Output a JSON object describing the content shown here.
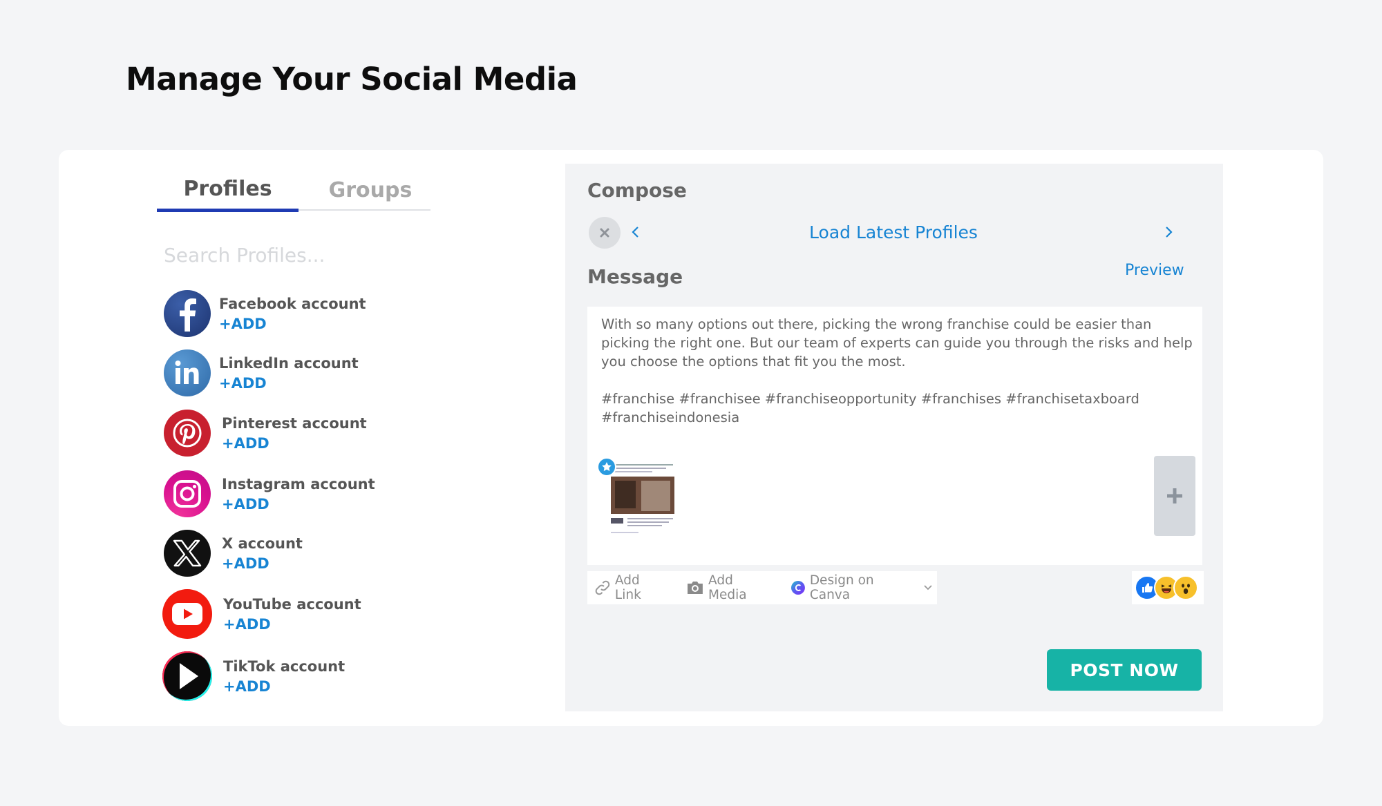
{
  "page": {
    "title": "Manage Your Social Media"
  },
  "tabs": [
    {
      "label": "Profiles",
      "active": true
    },
    {
      "label": "Groups",
      "active": false
    }
  ],
  "search": {
    "placeholder": "Search Profiles..."
  },
  "profiles": [
    {
      "name": "Facebook account",
      "action": "+ADD",
      "icon": "facebook-icon",
      "color": "#2b4a8c"
    },
    {
      "name": "LinkedIn account",
      "action": "+ADD",
      "icon": "linkedin-icon",
      "color": "#3e7fc0"
    },
    {
      "name": "Pinterest account",
      "action": "+ADD",
      "icon": "pinterest-icon",
      "color": "#c8202f"
    },
    {
      "name": "Instagram account",
      "action": "+ADD",
      "icon": "instagram-icon",
      "color": "#e0179c"
    },
    {
      "name": "X account",
      "action": "+ADD",
      "icon": "x-icon",
      "color": "#111111"
    },
    {
      "name": "YouTube account",
      "action": "+ADD",
      "icon": "youtube-icon",
      "color": "#f21b0f"
    },
    {
      "name": "TikTok account",
      "action": "+ADD",
      "icon": "tiktok-icon",
      "color": "#0a0a0a"
    }
  ],
  "compose": {
    "title": "Compose",
    "load_profiles": "Load Latest Profiles",
    "message_label": "Message",
    "preview": "Preview",
    "message_text": "With so many options out there, picking the wrong franchise could be easier than picking the right one. But our team of experts can guide you through the risks and help you choose the options that fit you the most.\n\n#franchise #franchisee #franchiseopportunity #franchises #franchisetaxboard #franchiseindonesia",
    "toolbar": {
      "add_link": "Add Link",
      "add_media": "Add Media",
      "design_canva": "Design on Canva"
    },
    "post_button": "POST NOW"
  },
  "colors": {
    "accent": "#1784d3",
    "tab_underline": "#1f3bb3",
    "post_button": "#17b3a6"
  }
}
